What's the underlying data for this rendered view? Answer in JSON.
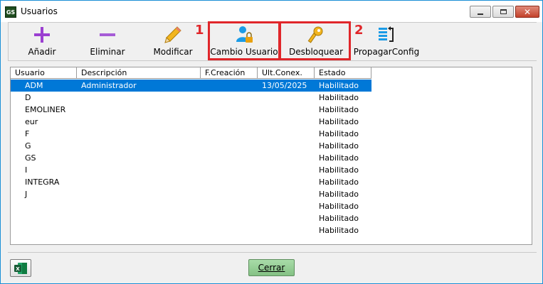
{
  "window": {
    "app_icon_text": "GS",
    "title": "Usuarios"
  },
  "toolbar": {
    "add_label": "Añadir",
    "delete_label": "Eliminar",
    "modify_label": "Modificar",
    "change_user_label": "Cambio Usuario",
    "unlock_label": "Desbloquear",
    "propagate_label": "PropagarConfig"
  },
  "annotations": {
    "box1_number": "1",
    "box2_number": "2",
    "color": "#e0262a"
  },
  "grid": {
    "columns": [
      "Usuario",
      "Descripción",
      "F.Creación",
      "Ult.Conex.",
      "Estado"
    ],
    "rows": [
      {
        "usuario": "ADM",
        "descripcion": "Administrador",
        "fcreacion": "",
        "ultconex": "13/05/2025",
        "estado": "Habilitado"
      },
      {
        "usuario": "D",
        "descripcion": "",
        "fcreacion": "",
        "ultconex": "",
        "estado": "Habilitado"
      },
      {
        "usuario": "EMOLINER",
        "descripcion": "",
        "fcreacion": "",
        "ultconex": "",
        "estado": "Habilitado"
      },
      {
        "usuario": "eur",
        "descripcion": "",
        "fcreacion": "",
        "ultconex": "",
        "estado": "Habilitado"
      },
      {
        "usuario": "F",
        "descripcion": "",
        "fcreacion": "",
        "ultconex": "",
        "estado": "Habilitado"
      },
      {
        "usuario": "G",
        "descripcion": "",
        "fcreacion": "",
        "ultconex": "",
        "estado": "Habilitado"
      },
      {
        "usuario": "GS",
        "descripcion": "",
        "fcreacion": "",
        "ultconex": "",
        "estado": "Habilitado"
      },
      {
        "usuario": "I",
        "descripcion": "",
        "fcreacion": "",
        "ultconex": "",
        "estado": "Habilitado"
      },
      {
        "usuario": "INTEGRA",
        "descripcion": "",
        "fcreacion": "",
        "ultconex": "",
        "estado": "Habilitado"
      },
      {
        "usuario": "J",
        "descripcion": "",
        "fcreacion": "",
        "ultconex": "",
        "estado": "Habilitado"
      },
      {
        "usuario": "",
        "descripcion": "",
        "fcreacion": "",
        "ultconex": "",
        "estado": "Habilitado"
      },
      {
        "usuario": "",
        "descripcion": "",
        "fcreacion": "",
        "ultconex": "",
        "estado": "Habilitado"
      },
      {
        "usuario": "",
        "descripcion": "",
        "fcreacion": "",
        "ultconex": "",
        "estado": "Habilitado"
      }
    ],
    "selected_row": 0
  },
  "footer": {
    "close_label": "Cerrar",
    "excel_icon": "excel-icon"
  },
  "colors": {
    "selection": "#0078d7",
    "close_button": "#84c184",
    "window_border": "#1a8fd6"
  }
}
